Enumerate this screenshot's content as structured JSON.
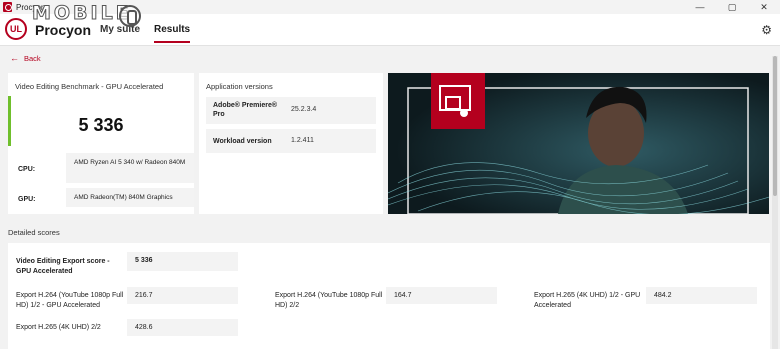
{
  "window": {
    "title": "Procyon",
    "controls": [
      "—",
      "▢",
      "✕"
    ]
  },
  "watermark": {
    "text": "MOBILE"
  },
  "header": {
    "logo_text": "UL",
    "brand": "Procyon",
    "tabs": [
      {
        "label": "My suite"
      },
      {
        "label": "Results",
        "active": true
      }
    ],
    "settings_icon": "gear-icon"
  },
  "back_label": "Back",
  "summary": {
    "benchmark_name": "Video Editing Benchmark - GPU Accelerated",
    "score": "5 336",
    "cpu_label": "CPU:",
    "cpu_value": "AMD Ryzen AI 5 340 w/ Radeon 840M",
    "gpu_label": "GPU:",
    "gpu_value": "AMD Radeon(TM) 840M Graphics",
    "accent_color": "#6fbf2c"
  },
  "versions": {
    "title": "Application versions",
    "rows": [
      {
        "name": "Adobe® Premiere® Pro",
        "value": "25.2.3.4"
      },
      {
        "name": "Workload version",
        "value": "1.2.411"
      }
    ]
  },
  "hero": {
    "accent_color": "#b4001e"
  },
  "detailed": {
    "title": "Detailed scores",
    "export_score_label": "Video Editing Export score - GPU Accelerated",
    "export_score_value": "5 336",
    "items": [
      {
        "label": "Export H.264 (YouTube 1080p Full HD) 1/2 - GPU Accelerated",
        "value": "216.7"
      },
      {
        "label": "Export H.264 (YouTube 1080p Full HD) 2/2",
        "value": "164.7"
      },
      {
        "label": "Export H.265 (4K UHD) 1/2 - GPU Accelerated",
        "value": "484.2"
      },
      {
        "label": "Export H.265 (4K UHD) 2/2",
        "value": "428.6"
      }
    ]
  }
}
